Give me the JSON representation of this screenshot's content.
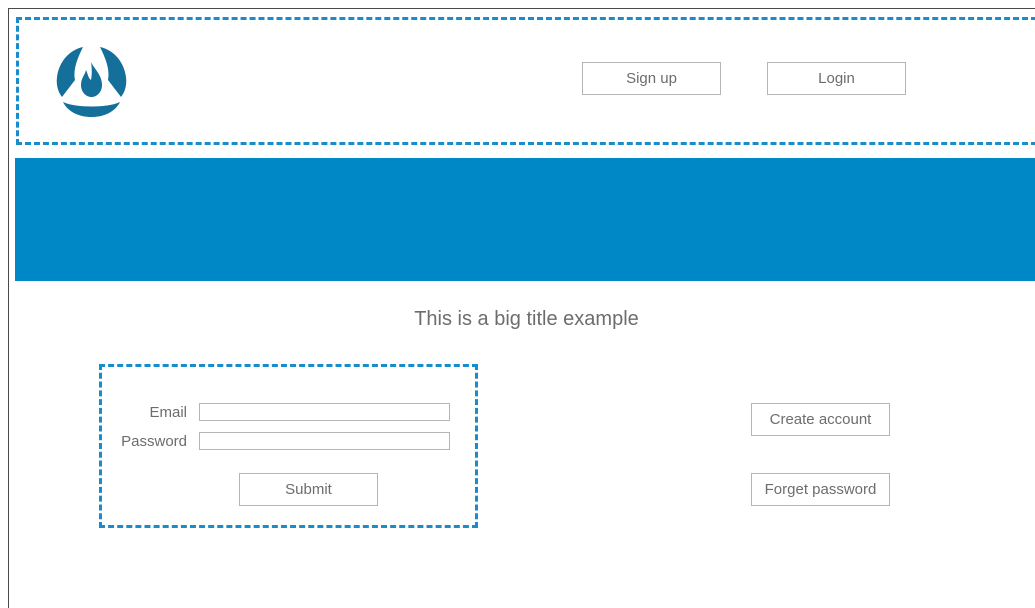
{
  "header": {
    "logo_icon": "flame-logo-icon",
    "signup_label": "Sign up",
    "login_label": "Login"
  },
  "hero": {
    "color": "#0088c6"
  },
  "main": {
    "title": "This is a big title example"
  },
  "form": {
    "email_label": "Email",
    "email_value": "",
    "password_label": "Password",
    "password_value": "",
    "submit_label": "Submit"
  },
  "actions": {
    "create_account_label": "Create account",
    "forget_password_label": "Forget password"
  },
  "colors": {
    "accent": "#0088c6",
    "logo": "#146f9b",
    "annotation_dash": "#1a8cc9"
  }
}
